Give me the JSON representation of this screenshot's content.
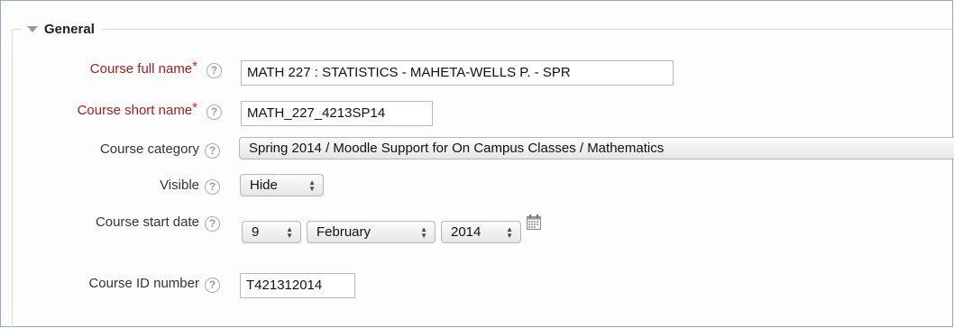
{
  "section": {
    "title": "General"
  },
  "required_marker": "*",
  "help_glyph": "?",
  "fields": {
    "full_name": {
      "label": "Course full name",
      "value": "MATH 227 : STATISTICS - MAHETA-WELLS P. - SPR"
    },
    "short_name": {
      "label": "Course short name",
      "value": "MATH_227_4213SP14"
    },
    "category": {
      "label": "Course category",
      "value": "Spring 2014 / Moodle Support for On Campus Classes / Mathematics"
    },
    "visible": {
      "label": "Visible",
      "value": "Hide"
    },
    "start_date": {
      "label": "Course start date",
      "day": "9",
      "month": "February",
      "year": "2014"
    },
    "id_number": {
      "label": "Course ID number",
      "value": "T421312014"
    }
  },
  "colors": {
    "required_label": "#a51d1d",
    "required_star": "#d31d1d",
    "border": "#8fa9c2"
  },
  "icons": [
    "collapse-triangle-icon",
    "help-icon",
    "calendar-icon"
  ]
}
